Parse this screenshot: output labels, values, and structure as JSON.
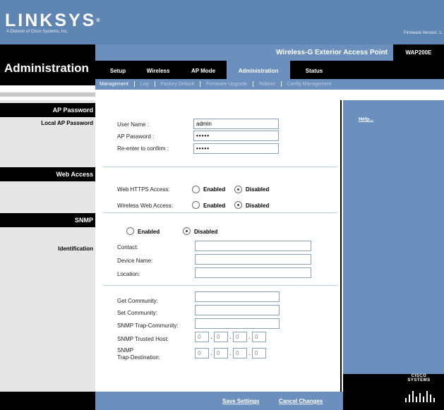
{
  "header": {
    "logo": "LINKSYS",
    "logo_mark": "®",
    "tagline": "A Division of Cisco Systems, Inc.",
    "firmware_label": "Firmware Version: 1.",
    "page_title": "Administration",
    "model_description": "Wireless-G Exterior Access Point",
    "model_name": "WAP200E"
  },
  "tabs": [
    {
      "label": "Setup",
      "active": false
    },
    {
      "label": "Wireless",
      "active": false
    },
    {
      "label": "AP Mode",
      "active": false
    },
    {
      "label": "Administration",
      "active": true
    },
    {
      "label": "Status",
      "active": false
    }
  ],
  "subtabs": [
    {
      "label": "Management",
      "active": true
    },
    {
      "label": "Log",
      "active": false
    },
    {
      "label": "Factory Default",
      "active": false
    },
    {
      "label": "Firmware Upgrade",
      "active": false
    },
    {
      "label": "Reboot",
      "active": false
    },
    {
      "label": "Config Management",
      "active": false
    }
  ],
  "sections": {
    "ap_password": {
      "heading": "AP Password",
      "sublabel": "Local AP Password",
      "user_name_label": "User Name :",
      "user_name_value": "admin",
      "ap_password_label": "AP Password :",
      "ap_password_value": "•••••",
      "reenter_label": "Re-enter to confirm :",
      "reenter_value": "•••••"
    },
    "web_access": {
      "heading": "Web Access",
      "https_label": "Web HTTPS Access:",
      "wireless_label": "Wireless Web Access:",
      "enabled_label": "Enabled",
      "disabled_label": "Disabled",
      "https_selected": "Disabled",
      "wireless_selected": "Disabled"
    },
    "snmp": {
      "heading": "SNMP",
      "sublabel": "Identification",
      "enabled_label": "Enabled",
      "disabled_label": "Disabled",
      "selected": "Disabled",
      "contact_label": "Contact:",
      "device_name_label": "Device Name:",
      "location_label": "Location:",
      "get_community_label": "Get Community:",
      "set_community_label": "Set Community:",
      "trap_community_label": "SNMP Trap-Community:",
      "trusted_host_label": "SNMP Trusted Host:",
      "trap_destination_label_1": "SNMP",
      "trap_destination_label_2": "Trap-Destination:",
      "ip_placeholder": "0"
    }
  },
  "help": {
    "label": "Help..."
  },
  "footer": {
    "save_label": "Save Settings",
    "cancel_label": "Cancel Changes"
  },
  "brand": {
    "cisco_label": "CISCO SYSTEMS"
  },
  "colors": {
    "accent_blue": "#6b90bd",
    "header_blue": "#5f86b3",
    "black": "#000000",
    "left_grey": "#e6e6e6"
  }
}
